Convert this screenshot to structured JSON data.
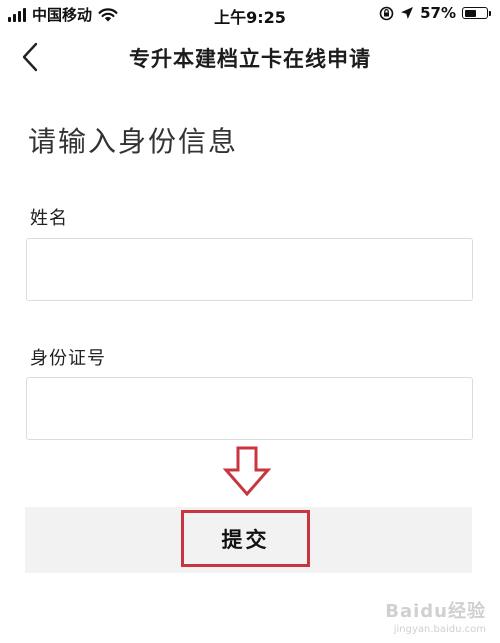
{
  "status_bar": {
    "carrier": "中国移动",
    "time": "上午9:25",
    "battery_percent_text": "57%",
    "battery_level": 0.57
  },
  "header": {
    "title": "专升本建档立卡在线申请"
  },
  "form": {
    "heading": "请输入身份信息",
    "name_label": "姓名",
    "name_value": "",
    "id_label": "身份证号",
    "id_value": "",
    "submit_label": "提交"
  },
  "watermark": {
    "brand": "Baidu经验",
    "url": "jingyan.baidu.com"
  },
  "colors": {
    "annotation_red": "#c9353f",
    "submit_band": "#f2f2f2",
    "input_border": "#dcdcdc"
  },
  "icons": {
    "back": "chevron-left-icon",
    "wifi": "wifi-icon",
    "signal": "signal-icon",
    "battery": "battery-icon",
    "location": "location-arrow-icon",
    "rotation_lock": "rotation-lock-icon",
    "arrow": "down-arrow-icon"
  }
}
